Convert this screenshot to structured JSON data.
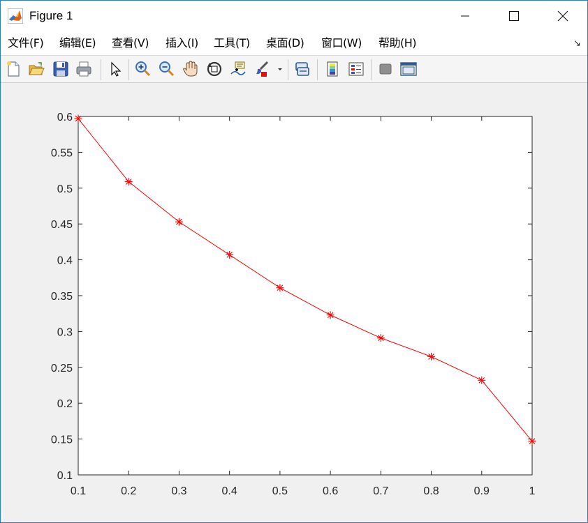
{
  "window": {
    "title": "Figure 1",
    "controls": {
      "minimize": "minimize",
      "maximize": "maximize",
      "close": "close"
    }
  },
  "menubar": {
    "items": [
      "文件(F)",
      "编辑(E)",
      "查看(V)",
      "插入(I)",
      "工具(T)",
      "桌面(D)",
      "窗口(W)",
      "帮助(H)"
    ]
  },
  "toolbar": {
    "icons": [
      "new-figure-icon",
      "open-file-icon",
      "save-icon",
      "print-icon",
      "select-pointer-icon",
      "zoom-in-icon",
      "zoom-out-icon",
      "pan-hand-icon",
      "rotate-3d-icon",
      "data-cursor-icon",
      "brush-icon",
      "brush-dropdown-icon",
      "link-plot-icon",
      "colorbar-icon",
      "legend-icon",
      "hide-plot-tools-icon",
      "show-plot-tools-icon"
    ]
  },
  "chart_data": {
    "type": "line",
    "title": "",
    "xlabel": "",
    "ylabel": "",
    "x": [
      0.1,
      0.2,
      0.3,
      0.4,
      0.5,
      0.6,
      0.7,
      0.8,
      0.9,
      1.0
    ],
    "series": [
      {
        "values": [
          0.597,
          0.509,
          0.453,
          0.407,
          0.361,
          0.323,
          0.291,
          0.265,
          0.232,
          0.147
        ],
        "color": "#ff0000",
        "marker": "asterisk",
        "line": "solid"
      }
    ],
    "xlim": [
      0.1,
      1.0
    ],
    "ylim": [
      0.1,
      0.6
    ],
    "xticks": [
      "0.1",
      "0.2",
      "0.3",
      "0.4",
      "0.5",
      "0.6",
      "0.7",
      "0.8",
      "0.9",
      "1"
    ],
    "yticks": [
      "0.1",
      "0.15",
      "0.2",
      "0.25",
      "0.3",
      "0.35",
      "0.4",
      "0.45",
      "0.5",
      "0.55",
      "0.6"
    ],
    "grid": false,
    "box": true
  }
}
